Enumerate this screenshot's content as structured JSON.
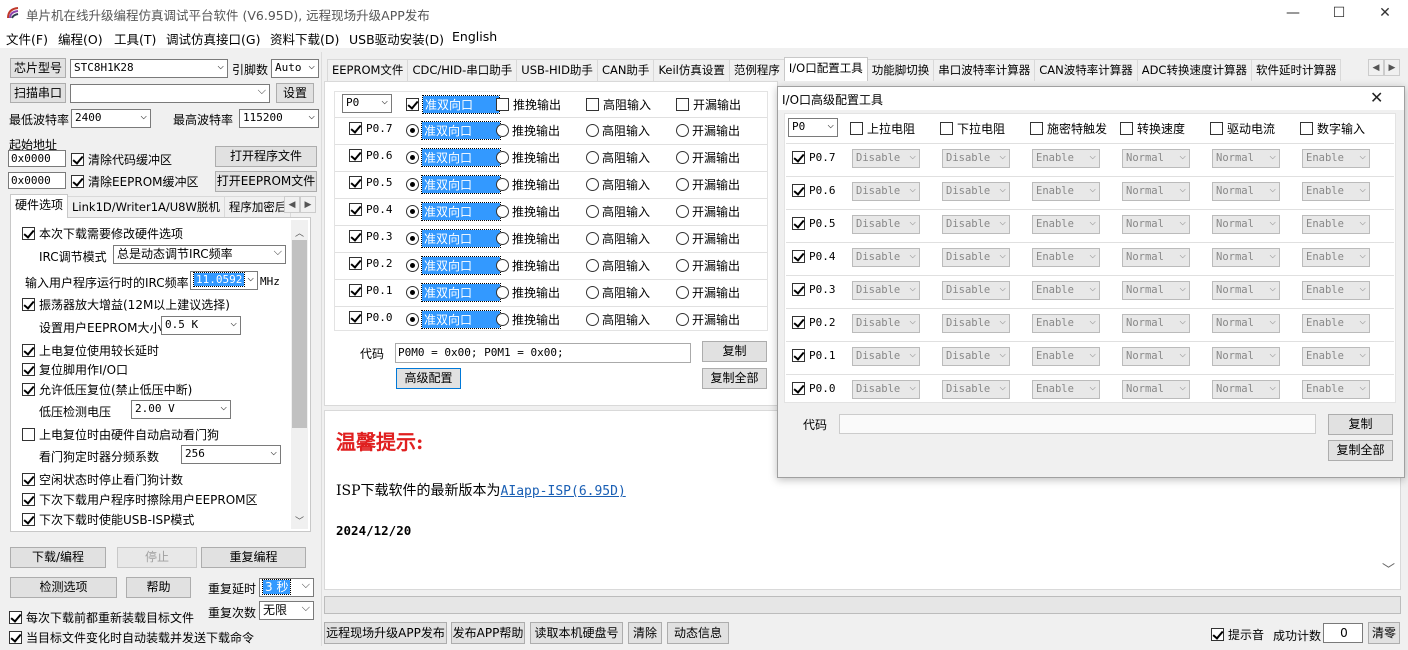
{
  "window": {
    "title": "单片机在线升级编程仿真调试平台软件 (V6.95D), 远程现场升级APP发布",
    "min": "—",
    "max": "☐",
    "close": "✕"
  },
  "menu": [
    "文件(F)",
    "编程(O)",
    "工具(T)",
    "调试仿真接口(G)",
    "资料下载(D)",
    "USB驱动安装(D)",
    "English"
  ],
  "left": {
    "chip_label": "芯片型号",
    "chip_value": "STC8H1K28",
    "pins_label": "引脚数",
    "pins_value": "Auto",
    "scan_port": "扫描串口",
    "port_value": "",
    "settings": "设置",
    "min_baud_label": "最低波特率",
    "min_baud": "2400",
    "max_baud_label": "最高波特率",
    "max_baud": "115200",
    "start_addr_label": "起始地址",
    "addr1": "0x0000",
    "clear_code": "清除代码缓冲区",
    "open_prog": "打开程序文件",
    "addr2": "0x0000",
    "clear_eeprom": "清除EEPROM缓冲区",
    "open_eeprom": "打开EEPROM文件",
    "tabs": [
      "硬件选项",
      "Link1D/Writer1A/U8W脱机",
      "程序加密后"
    ],
    "hw": {
      "opt1": "本次下载需要修改硬件选项",
      "irc_label": "IRC调节模式",
      "irc_value": "总是动态调节IRC频率",
      "freq_label": "输入用户程序运行时的IRC频率",
      "freq_value": "11.0592",
      "freq_unit": "MHz",
      "opt2": "振荡器放大增益(12M以上建议选择)",
      "eeprom_label": "设置用户EEPROM大小",
      "eeprom_value": "0.5 K",
      "opt3": "上电复位使用较长延时",
      "opt4": "复位脚用作I/O口",
      "opt5": "允许低压复位(禁止低压中断)",
      "lv_label": "低压检测电压",
      "lv_value": "2.00 V",
      "opt6": "上电复位时由硬件自动启动看门狗",
      "wdt_label": "看门狗定时器分频系数",
      "wdt_value": "256",
      "opt7": "空闲状态时停止看门狗计数",
      "opt8": "下次下载用户程序时擦除用户EEPROM区",
      "opt9": "下次下载时使能USB-ISP模式"
    },
    "download": "下载/编程",
    "stop": "停止",
    "reprog": "重复编程",
    "check": "检测选项",
    "help": "帮助",
    "delay_label": "重复延时",
    "delay_value": "3 秒",
    "reload": "每次下载前都重新装载目标文件",
    "count_label": "重复次数",
    "count_value": "无限",
    "auto_send": "当目标文件变化时自动装载并发送下载命令"
  },
  "tabs": [
    "EEPROM文件",
    "CDC/HID-串口助手",
    "USB-HID助手",
    "CAN助手",
    "Keil仿真设置",
    "范例程序",
    "I/O口配置工具",
    "功能脚切换",
    "串口波特率计算器",
    "CAN波特率计算器",
    "ADC转换速度计算器",
    "软件延时计算器"
  ],
  "io": {
    "port": "P0",
    "modes": [
      "准双向口",
      "推挽输出",
      "高阻输入",
      "开漏输出"
    ],
    "pins": [
      "P0.7",
      "P0.6",
      "P0.5",
      "P0.4",
      "P0.3",
      "P0.2",
      "P0.1",
      "P0.0"
    ],
    "code_label": "代码",
    "code_value": "P0M0 = 0x00; P0M1 = 0x00;",
    "copy": "复制",
    "copy_all": "复制全部",
    "advanced": "高级配置"
  },
  "info": {
    "title": "温馨提示:",
    "latest_prefix": "ISP下载软件的最新版本为",
    "latest_link": "AIapp-ISP(6.95D)",
    "date": "2024/12/20"
  },
  "adv": {
    "title": "I/O口高级配置工具",
    "close": "✕",
    "port": "P0",
    "headers": [
      "上拉电阻",
      "下拉电阻",
      "施密特触发",
      "转换速度",
      "驱动电流",
      "数字输入"
    ],
    "pins": [
      "P0.7",
      "P0.6",
      "P0.5",
      "P0.4",
      "P0.3",
      "P0.2",
      "P0.1",
      "P0.0"
    ],
    "values": [
      "Disable",
      "Disable",
      "Enable",
      "Normal",
      "Normal",
      "Enable"
    ],
    "code_label": "代码",
    "code_value": "",
    "copy": "复制",
    "copy_all": "复制全部"
  },
  "bottom": {
    "b1": "远程现场升级APP发布",
    "b2": "发布APP帮助",
    "b3": "读取本机硬盘号",
    "b4": "清除",
    "b5": "动态信息",
    "beep": "提示音",
    "succ_label": "成功计数",
    "succ_value": "0",
    "reset": "清零"
  },
  "colors": {
    "accent": "#0078d7",
    "link": "#1a5fb4",
    "warn": "#e02020",
    "selected": "#3399ff"
  }
}
